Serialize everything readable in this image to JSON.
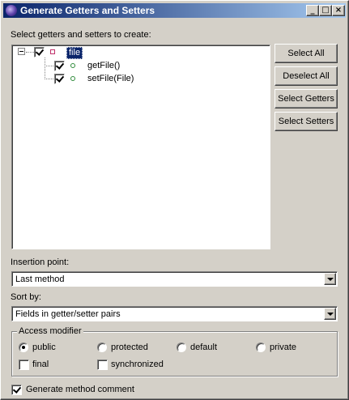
{
  "window": {
    "title": "Generate Getters and Setters",
    "controls": [
      "minimize-icon",
      "maximize-icon",
      "close-icon"
    ]
  },
  "select_label": "Select getters and setters to create:",
  "tree": {
    "root": {
      "label": "file",
      "checked": true,
      "icon": "field-icon"
    },
    "children": [
      {
        "label": "getFile()",
        "checked": true,
        "icon": "method-icon"
      },
      {
        "label": "setFile(File)",
        "checked": true,
        "icon": "method-icon"
      }
    ]
  },
  "buttons": {
    "select_all": "Select All",
    "deselect_all": "Deselect All",
    "select_getters": "Select Getters",
    "select_setters": "Select Setters"
  },
  "insertion_point": {
    "label": "Insertion point:",
    "value": "Last method"
  },
  "sort_by": {
    "label": "Sort by:",
    "value": "Fields in getter/setter pairs"
  },
  "access_modifier": {
    "title": "Access modifier",
    "radios": [
      {
        "label": "public",
        "selected": true
      },
      {
        "label": "protected",
        "selected": false
      },
      {
        "label": "default",
        "selected": false
      },
      {
        "label": "private",
        "selected": false
      }
    ],
    "checks": [
      {
        "label": "final",
        "checked": false
      },
      {
        "label": "synchronized",
        "checked": false
      }
    ]
  },
  "generate_comment": {
    "label": "Generate method comment",
    "checked": true
  }
}
